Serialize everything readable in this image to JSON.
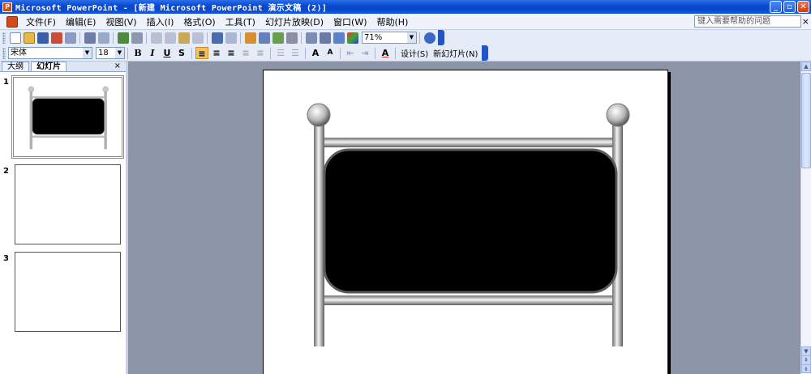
{
  "window": {
    "title": "Microsoft PowerPoint - [新建 Microsoft PowerPoint 演示文稿 (2)]",
    "minimize": "_",
    "restore": "▫",
    "close": "✕"
  },
  "menu": {
    "items": [
      "文件(F)",
      "编辑(E)",
      "视图(V)",
      "插入(I)",
      "格式(O)",
      "工具(T)",
      "幻灯片放映(D)",
      "窗口(W)",
      "帮助(H)"
    ],
    "help_placeholder": "键入需要帮助的问题",
    "help_close": "×"
  },
  "toolbar": {
    "zoom": "71%",
    "font": "宋体",
    "font_size": "18",
    "bold": "B",
    "italic": "I",
    "underline": "U",
    "shadow": "S",
    "design_label": "设计(S)",
    "new_slide_label": "新幻灯片(N)"
  },
  "pane": {
    "tab_outline": "大纲",
    "tab_slides": "幻灯片",
    "close": "×",
    "slides": [
      {
        "number": "1",
        "selected": true
      },
      {
        "number": "2",
        "selected": false
      },
      {
        "number": "3",
        "selected": false
      }
    ]
  },
  "colors": {
    "title_bar": "#0a4ad1",
    "board_fill": "#000000",
    "workspace": "#8c95a8"
  }
}
